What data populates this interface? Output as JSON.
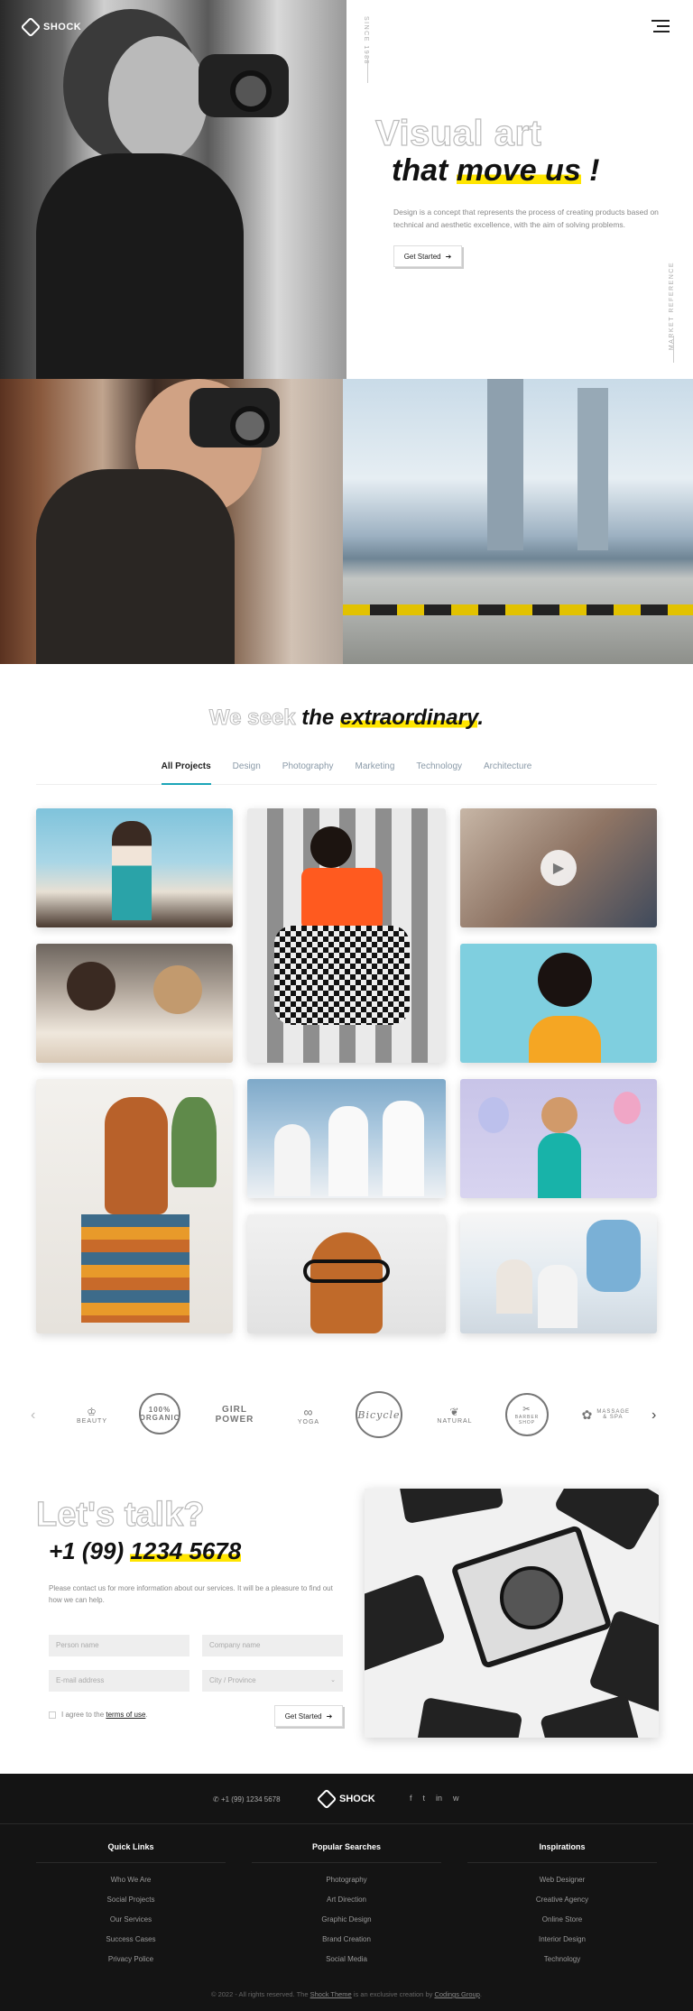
{
  "brand": {
    "name": "SHOCK"
  },
  "hero": {
    "since": "SINCE 1988",
    "market_ref": "MARKET REFERENCE",
    "title_outline": "Visual art",
    "title_prefix": "that ",
    "title_highlight": "move us",
    "title_suffix": " !",
    "description": "Design is a concept that represents the process of creating products based on technical and aesthetic excellence, with the aim of solving problems.",
    "cta": "Get Started"
  },
  "portfolio": {
    "title_outline": "We seek",
    "title_prefix": " the ",
    "title_highlight": "extraordinary",
    "title_suffix": ".",
    "tabs": [
      {
        "label": "All Projects",
        "active": true
      },
      {
        "label": "Design"
      },
      {
        "label": "Photography"
      },
      {
        "label": "Marketing"
      },
      {
        "label": "Technology"
      },
      {
        "label": "Architecture"
      }
    ]
  },
  "brands": {
    "items": [
      "BEAUTY",
      "100% ORGANIC",
      "GIRL POWER",
      "YOGA",
      "Bicycle",
      "NATURAL",
      "BARBER SHOP",
      "MASSAGE & SPA"
    ]
  },
  "contact": {
    "title": "Let's talk?",
    "phone_prefix": "+1 (99) ",
    "phone_highlight": "1234 5678",
    "description": "Please contact us for more information about our services. It will be a pleasure to find out how we can help.",
    "fields": {
      "person": "Person name",
      "company": "Company name",
      "email": "E-mail address",
      "city": "City / Province"
    },
    "terms_prefix": "I agree to the ",
    "terms_link": "terms of use",
    "terms_suffix": ".",
    "submit": "Get Started"
  },
  "footer": {
    "phone": "+1 (99) 1234 5678",
    "social": [
      "f",
      "t",
      "in",
      "w"
    ],
    "columns": [
      {
        "title": "Quick Links",
        "items": [
          "Who We Are",
          "Social Projects",
          "Our Services",
          "Success Cases",
          "Privacy Police"
        ]
      },
      {
        "title": "Popular Searches",
        "items": [
          "Photography",
          "Art Direction",
          "Graphic Design",
          "Brand Creation",
          "Social Media"
        ]
      },
      {
        "title": "Inspirations",
        "items": [
          "Web Designer",
          "Creative Agency",
          "Online Store",
          "Interior Design",
          "Technology"
        ]
      }
    ],
    "copyright_prefix": "© 2022 - All rights reserved. The ",
    "copyright_theme": "Shock Theme",
    "copyright_mid": " is an exclusive creation by ",
    "copyright_author": "Codings Group",
    "copyright_suffix": "."
  },
  "colors": {
    "accent": "#ffe500",
    "teal": "#1ba5b8",
    "footer_bg": "#141414"
  }
}
